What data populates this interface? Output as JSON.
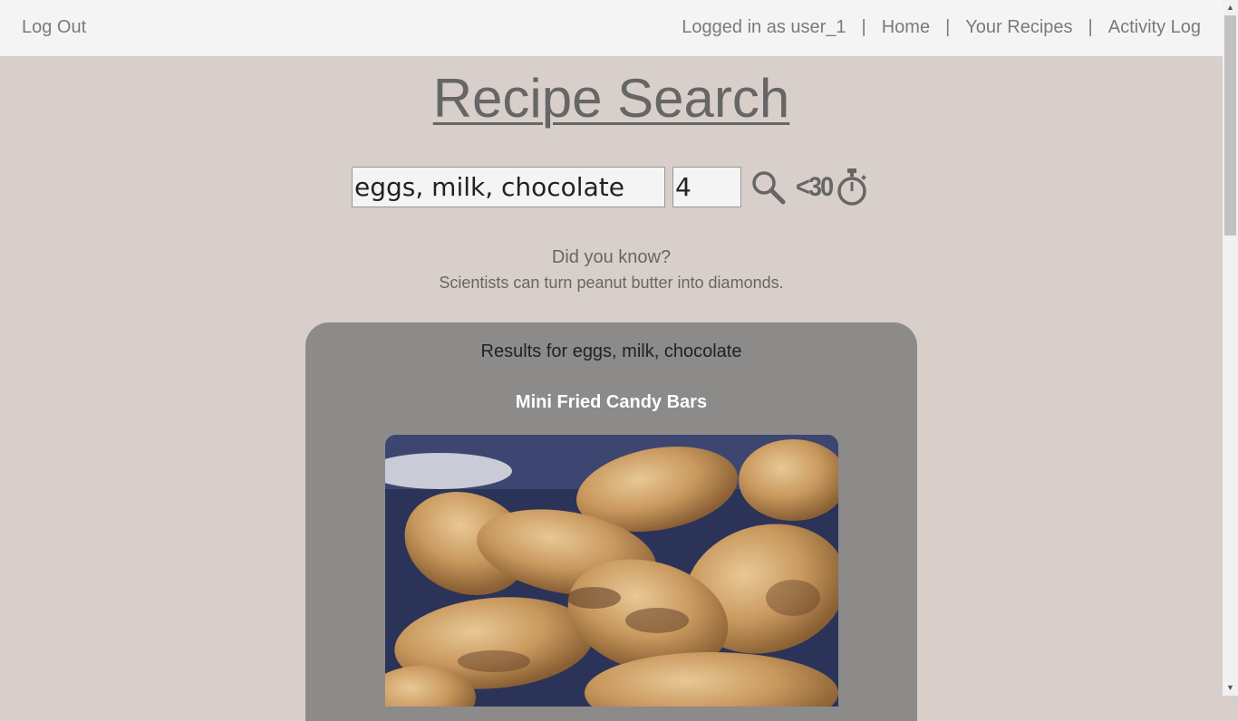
{
  "nav": {
    "logout": "Log Out",
    "logged_in": "Logged in as user_1",
    "separator": "|",
    "home": "Home",
    "your_recipes": "Your Recipes",
    "activity_log": "Activity Log"
  },
  "page": {
    "title": "Recipe Search"
  },
  "search": {
    "ingredients_value": "eggs, milk, chocolate",
    "count_value": "4",
    "search_icon": "magnifier-icon",
    "timer_label": "<30",
    "timer_icon": "stopwatch-icon"
  },
  "fact": {
    "heading": "Did you know?",
    "text": "Scientists can turn peanut butter into diamonds."
  },
  "results": {
    "heading": "Results for eggs, milk, chocolate",
    "items": [
      {
        "title": "Mini Fried Candy Bars"
      }
    ]
  },
  "colors": {
    "background": "#d8cfca",
    "topbar": "#f4f4f4",
    "results_panel": "#8c8b8a"
  }
}
